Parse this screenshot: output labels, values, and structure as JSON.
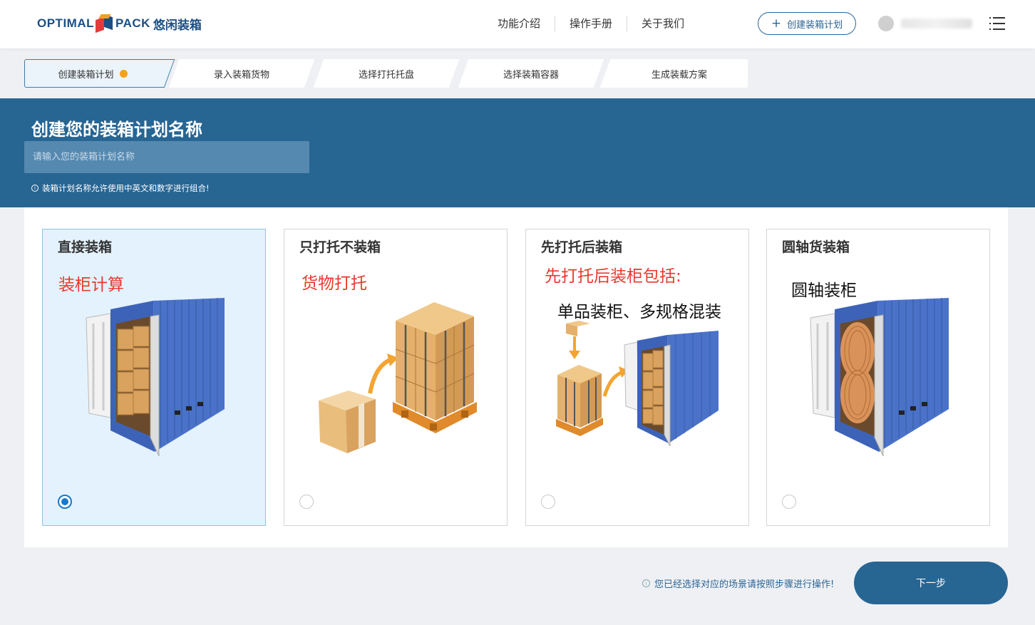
{
  "header": {
    "logo_text_left": "OPTIMAL",
    "logo_text_right": "PACK",
    "logo_cn": "悠闲装箱",
    "nav": [
      "功能介绍",
      "操作手册",
      "关于我们"
    ],
    "create_plan_label": "创建装箱计划"
  },
  "steps": [
    {
      "label": "创建装箱计划",
      "active": true
    },
    {
      "label": "录入装箱货物",
      "active": false
    },
    {
      "label": "选择打托托盘",
      "active": false
    },
    {
      "label": "选择装箱容器",
      "active": false
    },
    {
      "label": "生成装载方案",
      "active": false
    }
  ],
  "banner": {
    "title": "创建您的装箱计划名称",
    "input_placeholder": "请输入您的装箱计划名称",
    "input_value": "",
    "hint": "装箱计划名称允许使用中英文和数字进行组合!"
  },
  "cards": [
    {
      "title": "直接装箱",
      "red_text": "装柜计算",
      "black_text": "",
      "selected": true
    },
    {
      "title": "只打托不装箱",
      "red_text": "货物打托",
      "black_text": "",
      "selected": false
    },
    {
      "title": "先打托后装箱",
      "red_text": "先打托后装柜包括:",
      "black_text": "单品装柜、多规格混装",
      "selected": false
    },
    {
      "title": "圆轴货装箱",
      "red_text": "",
      "black_text": "圆轴装柜",
      "selected": false
    }
  ],
  "footer": {
    "hint": "您已经选择对应的场景请按照步骤进行操作!",
    "next_label": "下一步"
  },
  "colors": {
    "primary": "#276593",
    "accent_orange": "#f5a11c",
    "red_text": "#e8392c",
    "selected_card_bg": "#e3f2fd",
    "container_blue": "#3d63b8"
  }
}
